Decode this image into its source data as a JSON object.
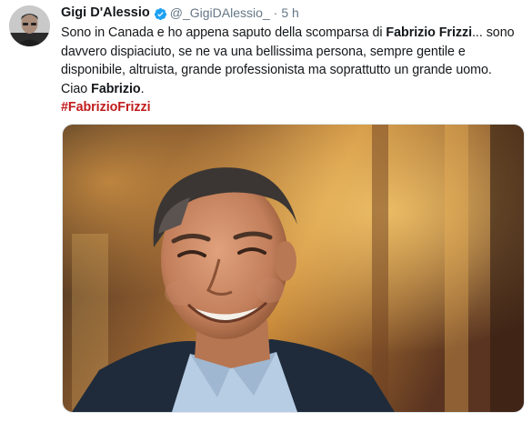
{
  "tweet": {
    "author_name": "Gigi D'Alessio",
    "handle": "@_GigiDAlessio_",
    "separator": "·",
    "time": "5 h",
    "text_1": "Sono in Canada e ho appena saputo della scomparsa di ",
    "bold_1": "Fabrizio Frizzi",
    "text_2": "... sono davvero dispiaciuto, se ne va una bellissima persona, sempre gentile e disponibile, altruista, grande professionista ma soprattutto un grande uomo.",
    "text_3": "Ciao ",
    "bold_2": "Fabrizio",
    "text_4": ".",
    "hashtag": "#FabrizioFrizzi"
  },
  "icons": {
    "verified": "verified-badge-icon",
    "avatar": "profile-avatar",
    "photo": "tweet-photo"
  },
  "colors": {
    "hashtag": "#c11c1c",
    "verified_badge": "#1da1f2",
    "secondary_text": "#657786"
  }
}
